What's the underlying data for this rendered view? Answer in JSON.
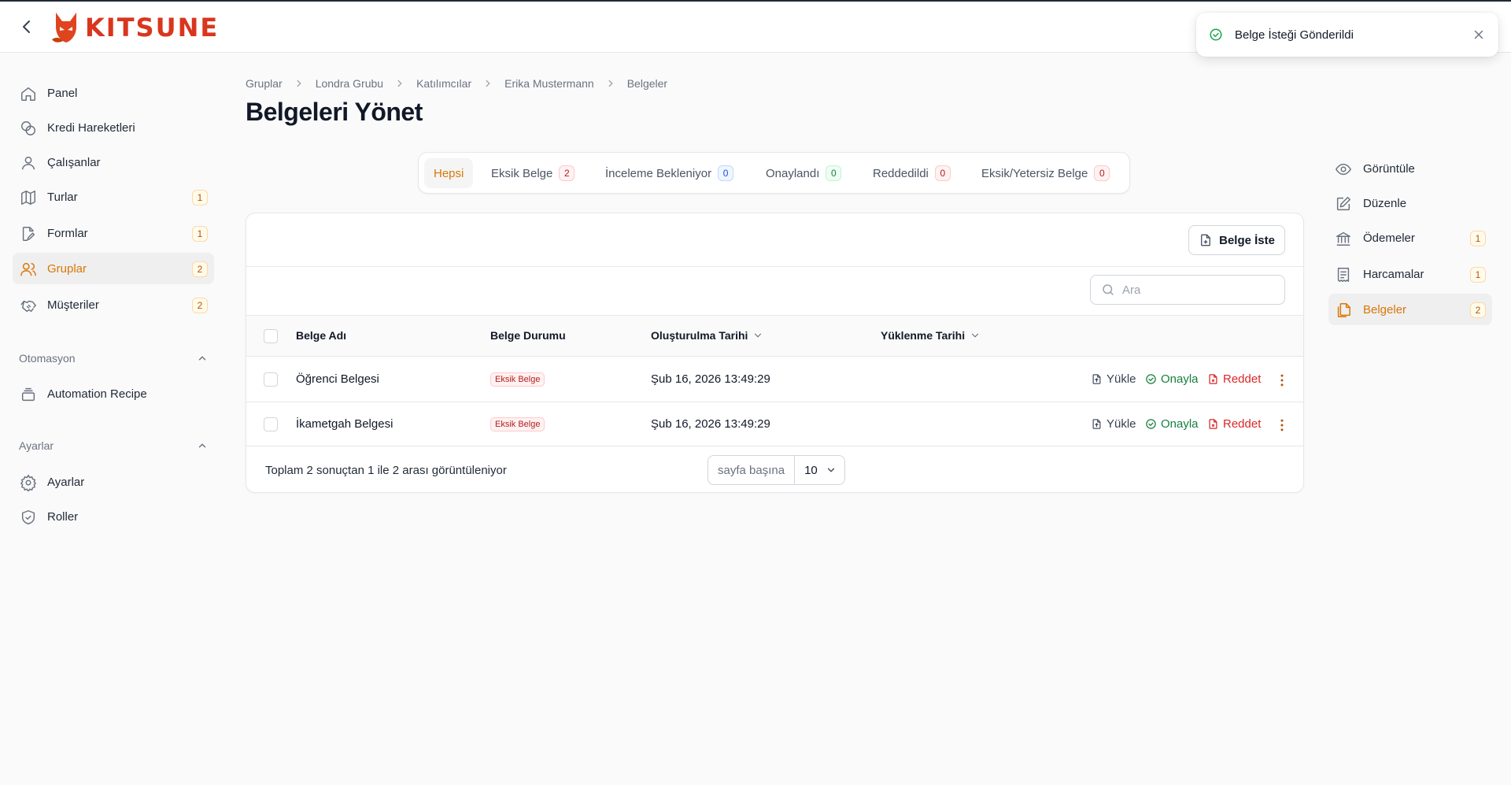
{
  "brand": {
    "name": "KITSUNE"
  },
  "sidebar": {
    "items": [
      {
        "label": "Panel",
        "icon": "home-icon"
      },
      {
        "label": "Kredi Hareketleri",
        "icon": "coins-icon"
      },
      {
        "label": "Çalışanlar",
        "icon": "user-icon"
      },
      {
        "label": "Turlar",
        "icon": "map-icon",
        "badge": "1"
      },
      {
        "label": "Formlar",
        "icon": "form-edit-icon",
        "badge": "1"
      },
      {
        "label": "Gruplar",
        "icon": "users-icon",
        "badge": "2",
        "active": true
      },
      {
        "label": "Müşteriler",
        "icon": "handshake-icon",
        "badge": "2"
      }
    ],
    "automation": {
      "title": "Otomasyon",
      "items": [
        {
          "label": "Automation Recipe",
          "icon": "stack-icon"
        }
      ]
    },
    "settings": {
      "title": "Ayarlar",
      "items": [
        {
          "label": "Ayarlar",
          "icon": "gear-icon"
        },
        {
          "label": "Roller",
          "icon": "shield-check-icon"
        }
      ]
    }
  },
  "breadcrumb": [
    "Gruplar",
    "Londra Grubu",
    "Katılımcılar",
    "Erika Mustermann",
    "Belgeler"
  ],
  "page_title": "Belgeleri Yönet",
  "tabs": [
    {
      "label": "Hepsi",
      "active": true
    },
    {
      "label": "Eksik Belge",
      "count": "2",
      "color": "red"
    },
    {
      "label": "İnceleme Bekleniyor",
      "count": "0",
      "color": "blue"
    },
    {
      "label": "Onaylandı",
      "count": "0",
      "color": "green"
    },
    {
      "label": "Reddedildi",
      "count": "0",
      "color": "red"
    },
    {
      "label": "Eksik/Yetersiz Belge",
      "count": "0",
      "color": "red"
    }
  ],
  "toolbar": {
    "request_label": "Belge İste",
    "search_placeholder": "Ara"
  },
  "table": {
    "columns": [
      "Belge Adı",
      "Belge Durumu",
      "Oluşturulma Tarihi",
      "Yüklenme Tarihi"
    ],
    "rows": [
      {
        "name": "Öğrenci Belgesi",
        "status": "Eksik Belge",
        "created": "Şub 16, 2026 13:49:29",
        "uploaded": ""
      },
      {
        "name": "İkametgah Belgesi",
        "status": "Eksik Belge",
        "created": "Şub 16, 2026 13:49:29",
        "uploaded": ""
      }
    ],
    "actions": {
      "upload": "Yükle",
      "approve": "Onayla",
      "reject": "Reddet"
    }
  },
  "pagination": {
    "summary": "Toplam 2 sonuçtan 1 ile 2 arası görüntüleniyor",
    "per_page_label": "sayfa başına",
    "per_page_value": "10"
  },
  "subnav": [
    {
      "label": "Görüntüle",
      "icon": "eye-icon"
    },
    {
      "label": "Düzenle",
      "icon": "pencil-icon"
    },
    {
      "label": "Ödemeler",
      "icon": "bank-icon",
      "badge": "1"
    },
    {
      "label": "Harcamalar",
      "icon": "receipt-icon",
      "badge": "1"
    },
    {
      "label": "Belgeler",
      "icon": "documents-icon",
      "badge": "2",
      "active": true
    }
  ],
  "toast": {
    "message": "Belge İsteği Gönderildi"
  },
  "colors": {
    "accent": "#d97706",
    "brand": "#d9361e",
    "success": "#16a34a",
    "danger": "#dc2626"
  }
}
